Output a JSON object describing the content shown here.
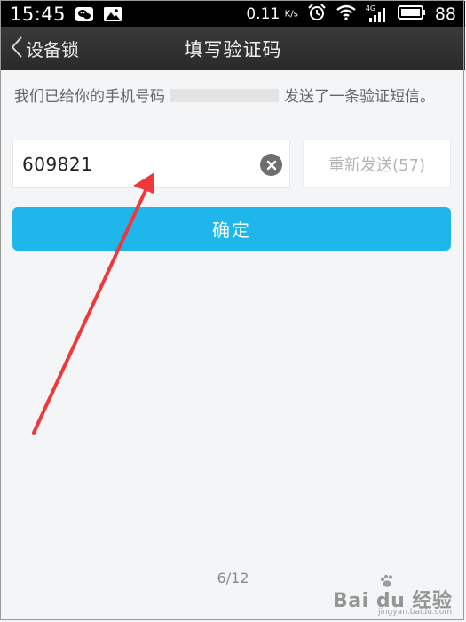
{
  "status_bar": {
    "time": "15:45",
    "network_speed": "0.11",
    "speed_unit": "K/s",
    "signal_type": "4G",
    "battery_level": "88",
    "icons": [
      "wechat-icon",
      "image-icon",
      "alarm-icon",
      "wifi-icon",
      "signal-icon",
      "battery-icon"
    ]
  },
  "nav": {
    "back_label": "设备锁",
    "title": "填写验证码"
  },
  "info": {
    "text_before": "我们已给你的手机号码",
    "text_after": "发送了一条验证短信。"
  },
  "code_input": {
    "value": "609821"
  },
  "resend": {
    "label": "重新发送(57)"
  },
  "confirm": {
    "label": "确定"
  },
  "footer": {
    "page_counter": "6/12"
  },
  "watermark": {
    "logo": "Bai du 经验",
    "sub": "jingyan.baidu.com"
  },
  "colors": {
    "accent": "#1fb6ec",
    "annotation_arrow": "#f0373b",
    "background": "#f4f5f7",
    "navbar": "#2f2f2f"
  }
}
